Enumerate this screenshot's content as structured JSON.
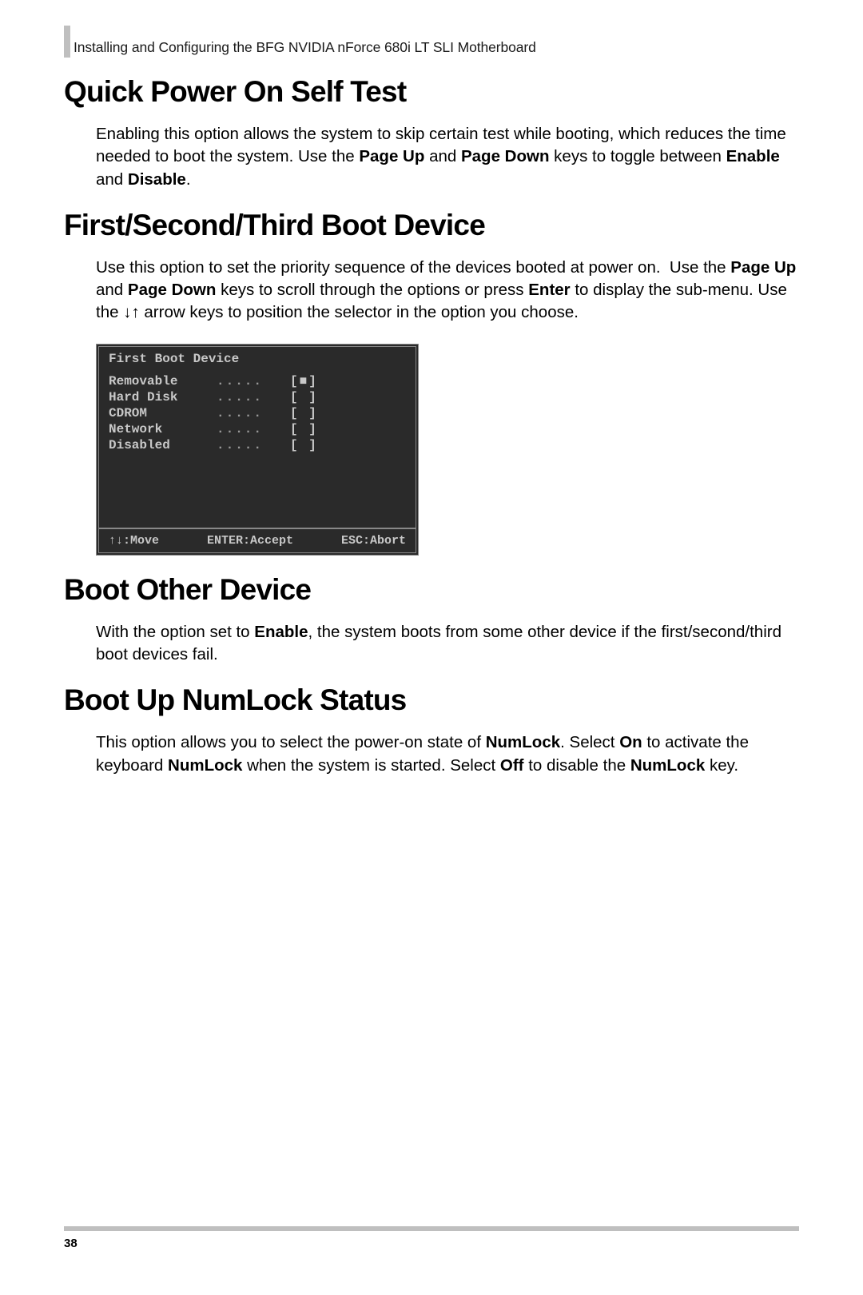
{
  "header": "Installing and Configuring the BFG NVIDIA nForce 680i LT SLI Motherboard",
  "s1": {
    "title": "Quick Power On Self Test",
    "p_html": "Enabling this option allows the system to skip certain test while booting, which reduces the time needed to boot the system. Use the <b>Page Up</b> and <b>Page Down</b> keys to toggle between <b>Enable</b> and <b>Disable</b>."
  },
  "s2": {
    "title": "First/Second/Third Boot Device",
    "p_html": "Use this option to set the priority sequence of the devices booted at power on.&nbsp; Use the <b>Page Up</b> and <b>Page Down</b> keys to scroll through the options or press <b>Enter</b> to display the sub-menu. Use the <span class='arrows'>&#8595;&#8593;</span> arrow keys to position the selector in the option you choose."
  },
  "bios": {
    "title": "First Boot Device",
    "rows": [
      {
        "label": "Removable",
        "mark": "[■]"
      },
      {
        "label": "Hard Disk",
        "mark": "[ ]"
      },
      {
        "label": "CDROM",
        "mark": "[ ]"
      },
      {
        "label": "Network",
        "mark": "[ ]"
      },
      {
        "label": "Disabled",
        "mark": "[ ]"
      }
    ],
    "footer_move": "↑↓:Move",
    "footer_accept": "ENTER:Accept",
    "footer_abort": "ESC:Abort"
  },
  "s3": {
    "title": "Boot Other Device",
    "p_html": "With the option set to <b>Enable</b>, the system boots from some other device if the first/second/third boot devices fail."
  },
  "s4": {
    "title": "Boot Up NumLock Status",
    "p_html": "This option allows you to select the power-on state of <b>NumLock</b>. Select <b>On</b> to activate the keyboard <b>NumLock</b> when the system is started. Select <b>Off</b> to disable the <b>NumLock</b> key."
  },
  "page_number": "38"
}
